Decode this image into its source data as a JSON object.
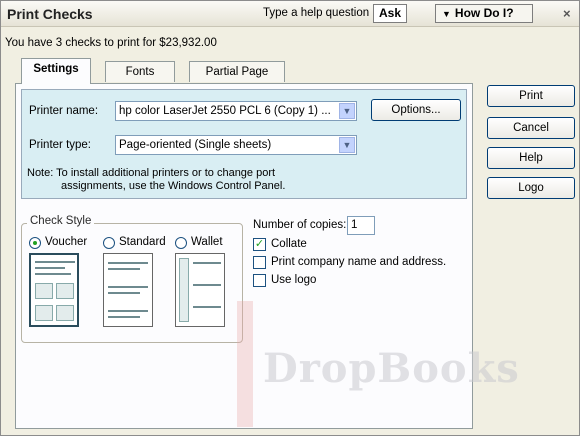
{
  "window": {
    "title": "Print Checks",
    "help_question": "Type a help question",
    "ask_label": "Ask",
    "how_do_i_label": "How Do I?",
    "close_glyph": "×"
  },
  "summary": "You have 3 checks to print for $23,932.00",
  "tabs": [
    {
      "label": "Settings",
      "active": true
    },
    {
      "label": "Fonts",
      "active": false
    },
    {
      "label": "Partial Page",
      "active": false
    }
  ],
  "printer": {
    "name_label": "Printer name:",
    "name_value": "hp color LaserJet 2550 PCL 6 (Copy 1) ...",
    "type_label": "Printer type:",
    "type_value": "Page-oriented (Single sheets)",
    "options_label": "Options...",
    "note_line1": "Note: To install additional printers or to change port",
    "note_line2": "assignments, use the Windows Control Panel."
  },
  "check_style": {
    "title": "Check Style",
    "options": [
      {
        "label": "Voucher",
        "selected": true
      },
      {
        "label": "Standard",
        "selected": false
      },
      {
        "label": "Wallet",
        "selected": false
      }
    ]
  },
  "options": {
    "copies_label": "Number of copies:",
    "copies_value": "1",
    "collate_label": "Collate",
    "collate_checked": true,
    "print_company_label": "Print company name and address.",
    "print_company_checked": false,
    "use_logo_label": "Use logo",
    "use_logo_checked": false
  },
  "buttons": {
    "print": "Print",
    "cancel": "Cancel",
    "help": "Help",
    "logo": "Logo"
  },
  "watermark": "DropBooks",
  "icons": {
    "dropdown": "chevron-down-icon",
    "close": "close-icon"
  }
}
